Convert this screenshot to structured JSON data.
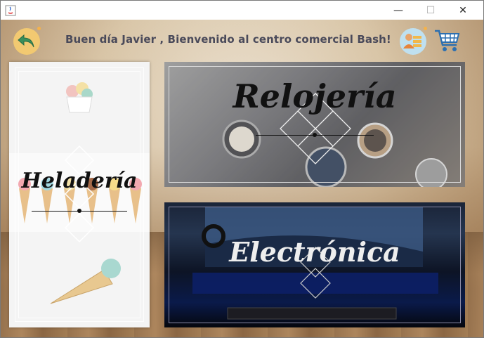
{
  "window": {
    "minimize_glyph": "—",
    "maximize_glyph": "☐",
    "close_glyph": "✕"
  },
  "header": {
    "greeting": "Buen día Javier , Bienvenido al centro comercial Bash!",
    "back_icon": "back-arrow-icon",
    "profile_icon": "profile-list-icon",
    "cart_icon": "shopping-cart-icon"
  },
  "categories": {
    "heladeria": "Heladería",
    "relojeria": "Relojería",
    "electronica": "Electrónica"
  },
  "colors": {
    "back_button": "#f2c971",
    "profile_button": "#bfe0f0",
    "cart": "#2c6fb0"
  }
}
